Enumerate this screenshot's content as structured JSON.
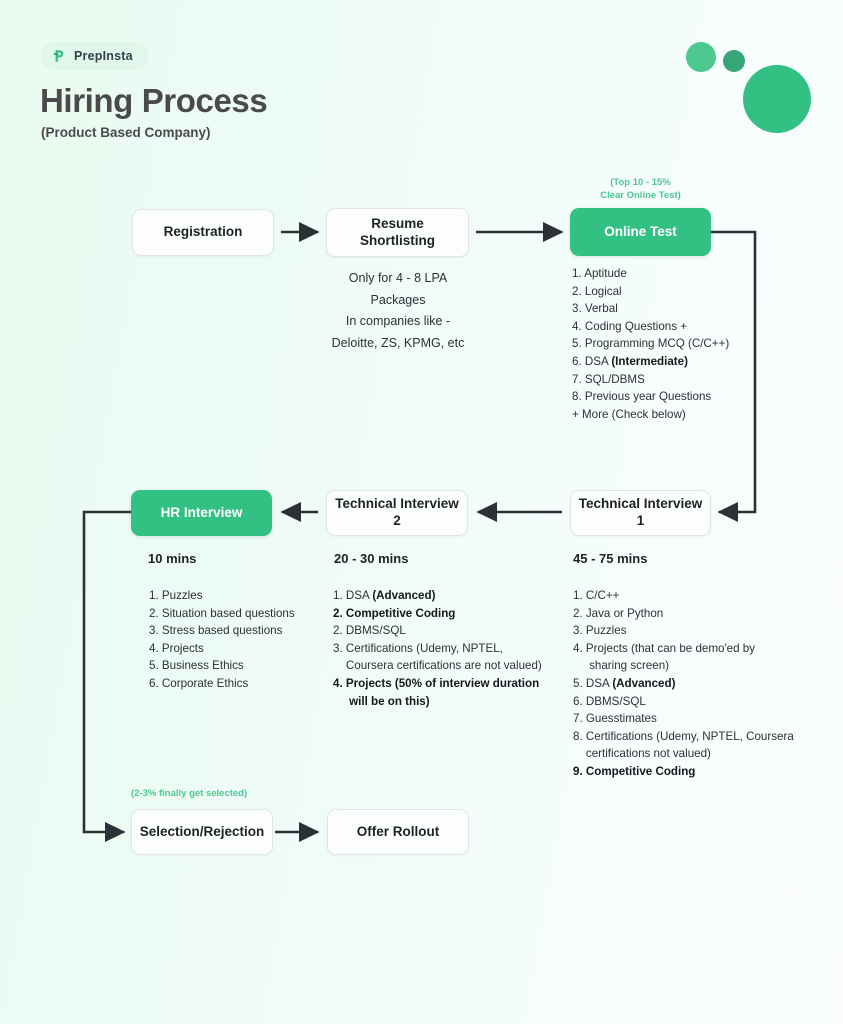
{
  "brand": {
    "name": "PrepInsta",
    "logo_icon": "prepinsta-p-icon",
    "accent": "#33c183",
    "pill_bg": "#e2f7ec"
  },
  "header": {
    "title": "Hiring Process",
    "subtitle": "(Product Based Company)"
  },
  "decor": {
    "circles": [
      {
        "name": "decor-circle-small-light",
        "color": "#4dc98f"
      },
      {
        "name": "decor-circle-small-dark",
        "color": "#36a578"
      },
      {
        "name": "decor-circle-large",
        "color": "#33c183"
      }
    ]
  },
  "nodes": {
    "registration": "Registration",
    "resume_shortlisting": "Resume\nShortlisting",
    "online_test": "Online Test",
    "technical_interview_1": "Technical Interview 1",
    "technical_interview_2": "Technical Interview 2",
    "hr_interview": "HR Interview",
    "selection_rejection": "Selection/Rejection",
    "offer_rollout": "Offer Rollout"
  },
  "annotations": {
    "online_test_rate": "(Top 10 - 15%\nClear Online Test)",
    "selection_rate": "(2-3% finally get selected)",
    "resume_note": "Only for 4 - 8 LPA\nPackages\nIn companies like -\nDeloitte, ZS, KPMG, etc"
  },
  "durations": {
    "hr_interview": "10 mins",
    "technical_interview_2": "20 - 30 mins",
    "technical_interview_1": "45 - 75 mins"
  },
  "lists": {
    "online_test": [
      {
        "text": "1. Aptitude"
      },
      {
        "text": "2. Logical"
      },
      {
        "text": "3. Verbal"
      },
      {
        "text": "4. Coding Questions +"
      },
      {
        "text": "5. Programming MCQ (C/C++)"
      },
      {
        "text": "6. DSA ",
        "bold_tail": "(Intermediate)"
      },
      {
        "text": "7. SQL/DBMS"
      },
      {
        "text": "8. Previous year Questions"
      },
      {
        "text": "+ More (Check below)"
      }
    ],
    "hr_interview": [
      {
        "text": "1. Puzzles"
      },
      {
        "text": "2. Situation based questions"
      },
      {
        "text": "3. Stress based questions"
      },
      {
        "text": "4. Projects"
      },
      {
        "text": "5. Business Ethics"
      },
      {
        "text": "6. Corporate Ethics"
      }
    ],
    "technical_interview_2": [
      {
        "text": "1. DSA ",
        "bold_tail": "(Advanced)"
      },
      {
        "text": "2. Competitive Coding",
        "all_bold": true
      },
      {
        "text": "2. DBMS/SQL"
      },
      {
        "text": "3. Certifications (Udemy, NPTEL,\n    Coursera certifications are not valued)"
      },
      {
        "text": "4. Projects (50% of interview duration\n     will be on this)",
        "all_bold": true
      }
    ],
    "technical_interview_1": [
      {
        "text": "1. C/C++"
      },
      {
        "text": "2. Java or Python"
      },
      {
        "text": "3. Puzzles"
      },
      {
        "text": "4. Projects (that can be demo'ed by\n     sharing screen)"
      },
      {
        "text": "5. DSA ",
        "bold_tail": "(Advanced)"
      },
      {
        "text": "6. DBMS/SQL"
      },
      {
        "text": "7. Guesstimates"
      },
      {
        "text": "8. Certifications (Udemy, NPTEL, Coursera\n    certifications not valued)"
      },
      {
        "text": "9. Competitive Coding",
        "all_bold": true
      }
    ]
  }
}
